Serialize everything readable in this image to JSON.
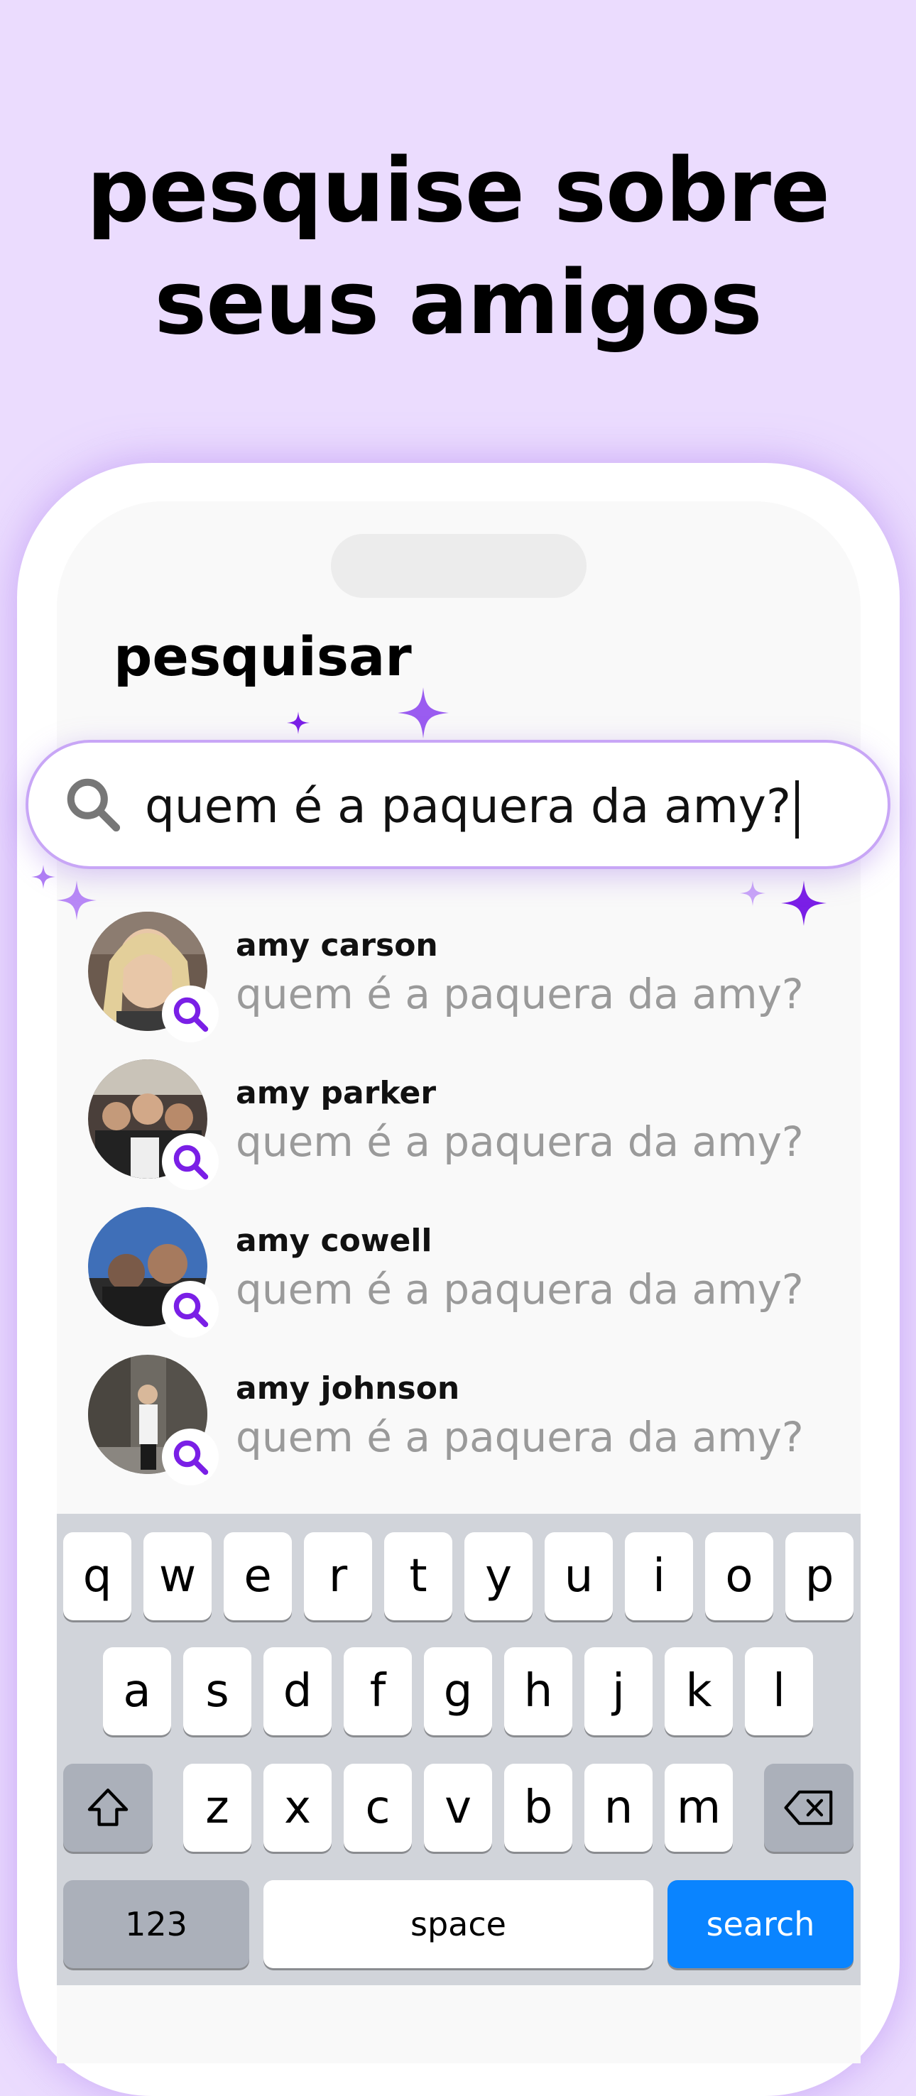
{
  "headline": {
    "line1": "pesquise sobre",
    "line2": "seus amigos"
  },
  "screen": {
    "title": "pesquisar"
  },
  "search": {
    "value": "quem é a paquera da amy?",
    "icon": "search-icon"
  },
  "results": [
    {
      "name": "amy carson",
      "query": "quem é a paquera da amy?"
    },
    {
      "name": "amy parker",
      "query": "quem é a paquera da amy?"
    },
    {
      "name": "amy cowell",
      "query": "quem é a paquera da amy?"
    },
    {
      "name": "amy johnson",
      "query": "quem é a paquera da amy?"
    }
  ],
  "keyboard": {
    "row1": [
      "q",
      "w",
      "e",
      "r",
      "t",
      "y",
      "u",
      "i",
      "o",
      "p"
    ],
    "row2": [
      "a",
      "s",
      "d",
      "f",
      "g",
      "h",
      "j",
      "k",
      "l"
    ],
    "row3": [
      "z",
      "x",
      "c",
      "v",
      "b",
      "n",
      "m"
    ],
    "numbers_label": "123",
    "space_label": "space",
    "search_label": "search"
  },
  "colors": {
    "background": "#ebdcfe",
    "accent": "#7a1fe6",
    "key_blue": "#0a84ff"
  }
}
